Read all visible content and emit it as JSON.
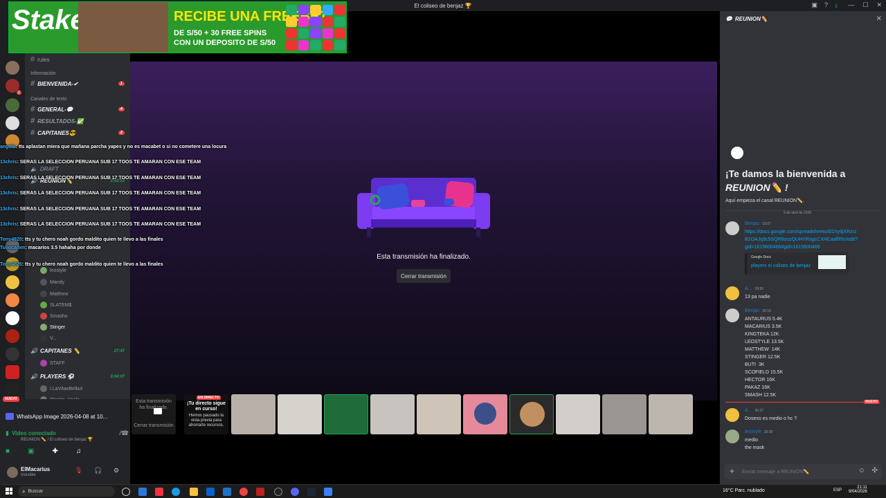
{
  "window": {
    "title": "El coliseo de benjaz 🏆"
  },
  "ad": {
    "logo": "Stake",
    "headline": "RECIBE UNA FREEBET",
    "sub": "DE S/50 + 30 FREE SPINS\nCON UN DEPOSITO DE S/50"
  },
  "channels": {
    "rules": "rules",
    "cat_info": "Información",
    "bienvenida": "BIENVENIDA-✔",
    "bienvenida_badge": "1",
    "cat_text": "Canales de texto",
    "general": "GENERAL-💬",
    "general_badge": "4",
    "resultados": "RESULTADOS-✅",
    "capitanes": "CAPITANES😎",
    "capitanes_badge": "2",
    "draft": "DRAFT",
    "reunion": "REUNION✏️",
    "reunion_time": "3:43:53",
    "users": [
      "leostyle",
      "Mandy",
      "Matthew",
      "SLATEM$",
      "Smasho",
      "Stinger",
      "V..."
    ],
    "capitanes_voice": "CAPITANES ✏️",
    "capitanes_time": "27:47",
    "staff": "STAFF",
    "players": "PLAYERS ⚽",
    "players_time": "3:04:07",
    "p1": "I.LaVitaeBellaX",
    "p2": "IPapita_Veela"
  },
  "chat_overlay": [
    {
      "name": "angelu",
      "text": ": tts aplastan miera que mañana parcha yapes y no es macabet o si no cometere una locura"
    },
    {
      "name": "13chris",
      "text": ": SERAS LA SELECCION PERUANA SUB 17 TOOS TE AMARAN CON ESE TEAM"
    },
    {
      "name": "13chris",
      "text": ": SERAS LA SELECCION PERUANA SUB 17 TOOS TE AMARAN CON ESE TEAM"
    },
    {
      "name": "13chris",
      "text": ": SERAS LA SELECCION PERUANA SUB 17 TOOS TE AMARAN CON ESE TEAM"
    },
    {
      "name": "13chris",
      "text": ": SERAS LA SELECCION PERUANA SUB 17 TOOS TE AMARAN CON ESE TEAM"
    },
    {
      "name": "13chris",
      "text": ": SERAS LA SELECCION PERUANA SUB 17 TOOS TE AMARAN CON ESE TEAM"
    },
    {
      "name": "Tony4825",
      "text": ": tts y tu chero noah gordo maldito quien te llevo a las finales"
    },
    {
      "name": "Tuliocamm",
      "text": ": macarios 3.5 hahaha por donde"
    },
    {
      "name": "Tony4825",
      "text": ": tts y tu chero noah gordo maldito quien te llevo a las finales"
    }
  ],
  "stage": {
    "ended_text": "Esta transmisión ha finalizado.",
    "close_button": "Cerrar transmisión",
    "thumb_ended": "Esta transmisión ha finalizado.",
    "thumb_close": "Cerrar transmisión",
    "live_tag": "EN DIRECTO",
    "live_title": "¡Tu directo sigue en curso!",
    "live_desc": "Hemos pausado la vista previa para ahorrarte recursos."
  },
  "self_panel": {
    "new_badge": "NUEVO",
    "share_title": "WhatsApp Image 2026-04-08 at 10...",
    "voice_status": "Video conectado",
    "voice_sub": "REUNION ✏️ / El coliseo de benjaz 🏆",
    "username": "ElMacarius",
    "status": "Invisible"
  },
  "right": {
    "header": "REUNION✏️",
    "welcome1": "¡Te damos la bienvenida a",
    "welcome2": "REUNION✏️ !",
    "welcome_sub": "Aquí empieza el canal REUNION✏️.",
    "date_divider": "9 de abril de 2026",
    "messages": [
      {
        "author": "Benjaz",
        "time": "19:07",
        "body": "https://docs.google.com/spreadsheets/d/1hy9jXRzrz\nB2OAJq9c5SQR6oozQUHYRagcCXHCaaf9Sc/edit?\ngid=1615600466#gid=1615600466"
      },
      {
        "author": "A...",
        "time": "19:26",
        "body": "13 pa nadie"
      },
      {
        "author": "Benjaz",
        "time": "20:19",
        "body": "ANTAURUS 5.4K\nMACARIUS 3.5K\nKINGTEKA 12K\nLEOSTYLE 13.5K\nMATTHEW  14K\nSTINGER 12.5K\nBUTI  3K\nSCOFIELD 15.5K\nHECTOR 16K\nPAKAZ 16K\nSMASH 12.5K"
      },
      {
        "author": "A...",
        "time": "20:27",
        "body": "Dosexo es medio o hc ?"
      },
      {
        "author": "leostyle",
        "time": "20:28",
        "body": "medio\nthe mask"
      }
    ],
    "embed_provider": "Google Docs",
    "embed_title": "players el coliseo de benjaz",
    "new_divider": "NUEVO",
    "input_placeholder": "Enviar mensaje a REUNION✏️"
  },
  "taskbar": {
    "search": "Buscar",
    "weather": "16°C  Parc. nublado",
    "lang": "ESP",
    "time": "21:11",
    "date": "9/04/2026"
  }
}
